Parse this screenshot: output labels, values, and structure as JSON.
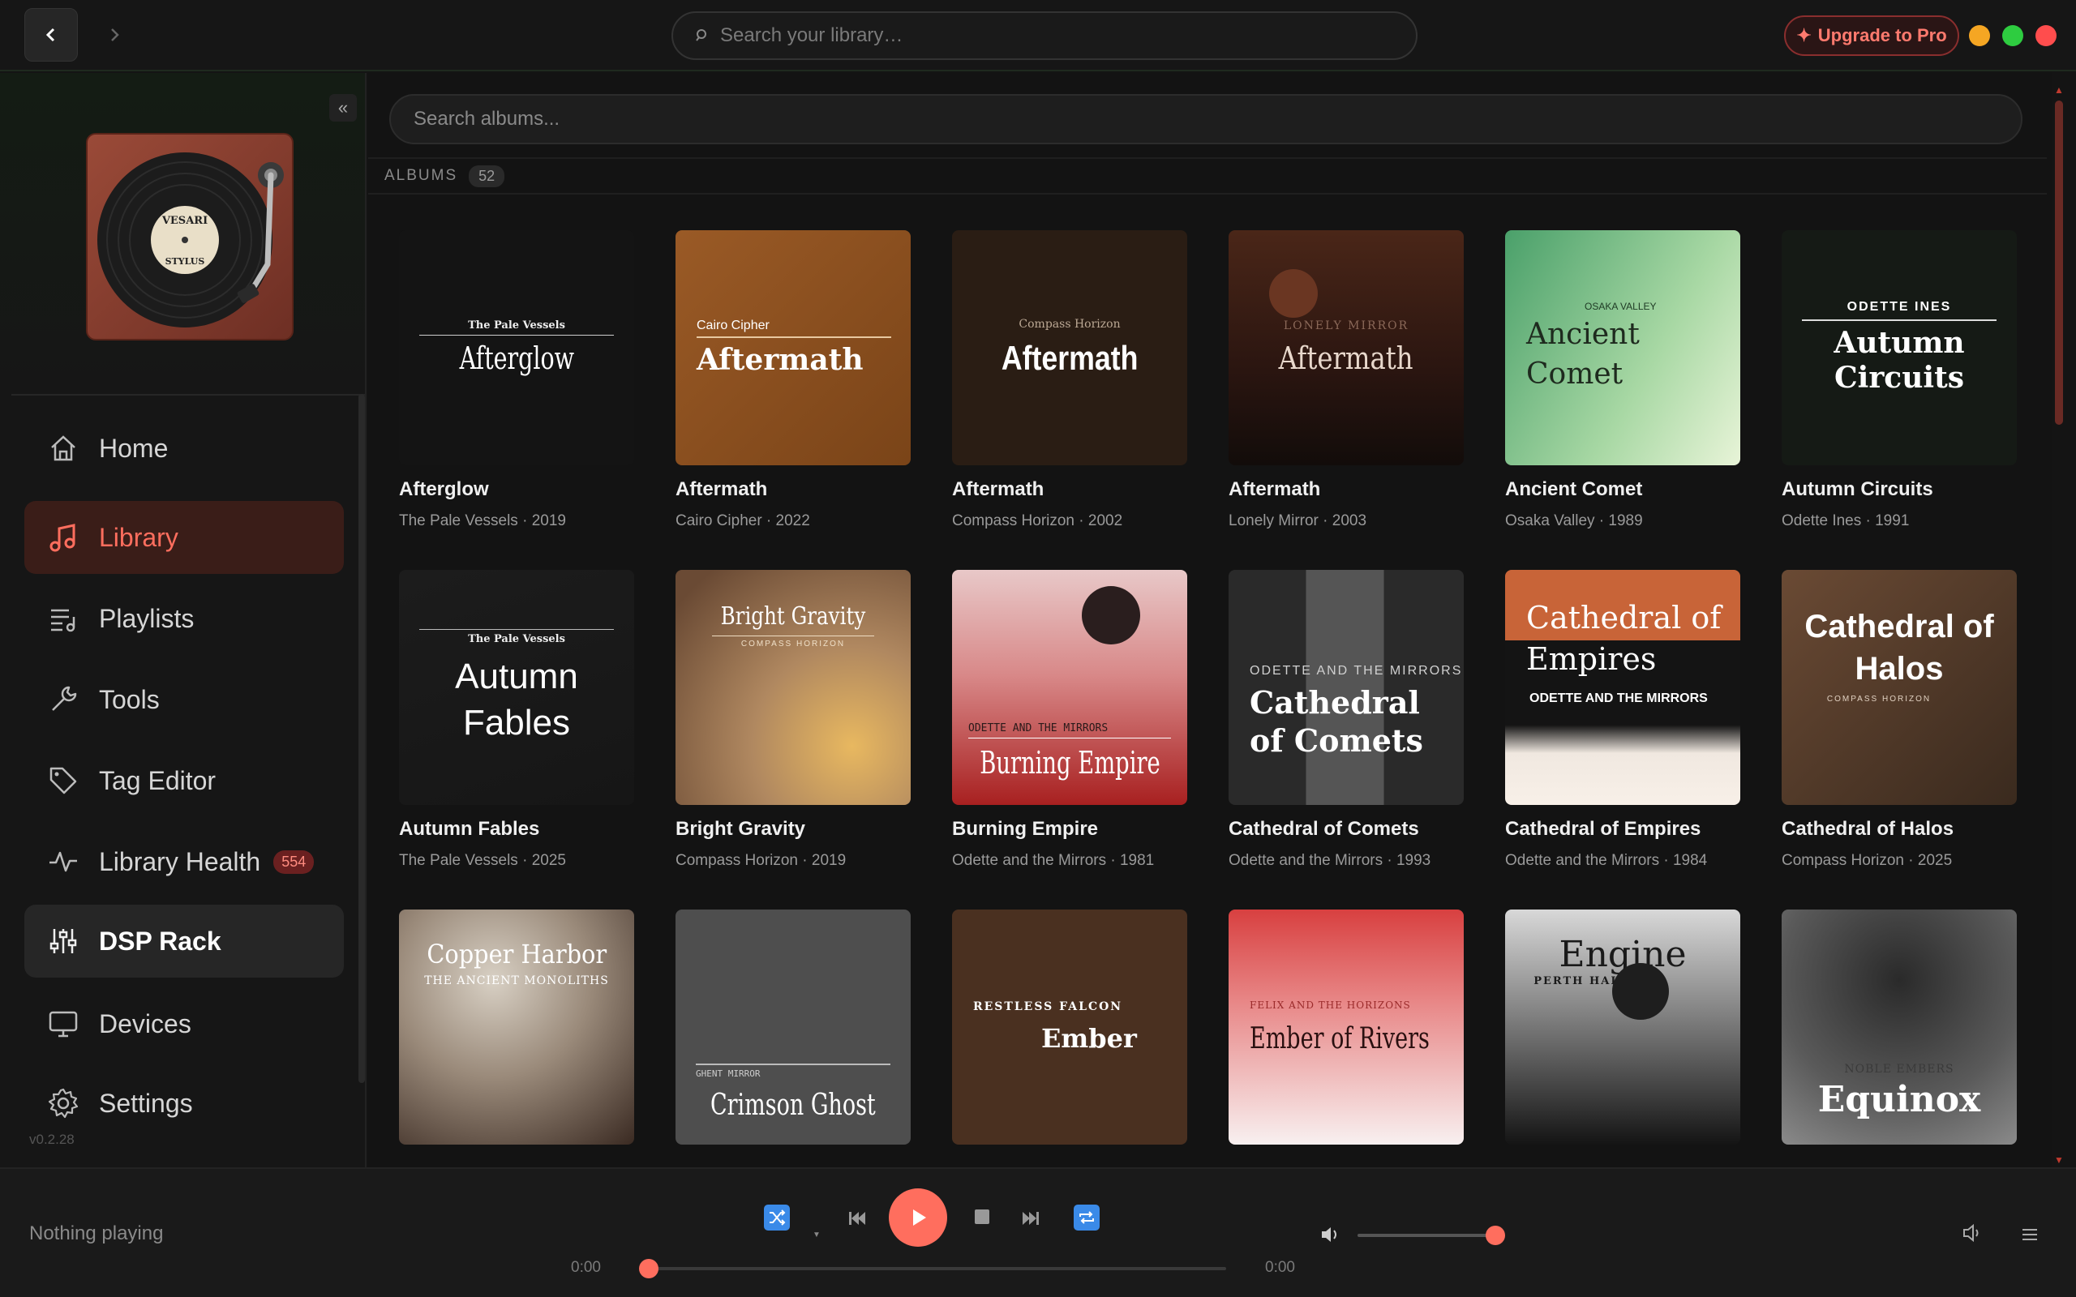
{
  "topbar": {
    "search_placeholder": "Search your library…",
    "upgrade_label": "Upgrade to Pro",
    "window_colors": [
      "#f5a623",
      "#2ecc40",
      "#ff4d4d"
    ]
  },
  "sidebar": {
    "logo_text_top": "VESARI",
    "logo_text_bottom": "STYLUS",
    "items": [
      {
        "label": "Home",
        "icon": "home-icon"
      },
      {
        "label": "Library",
        "icon": "music-note-icon",
        "active": true
      },
      {
        "label": "Playlists",
        "icon": "playlist-icon"
      },
      {
        "label": "Tools",
        "icon": "wrench-icon"
      },
      {
        "label": "Tag Editor",
        "icon": "tag-icon"
      },
      {
        "label": "Library Health",
        "icon": "pulse-icon",
        "badge": "554"
      },
      {
        "label": "DSP Rack",
        "icon": "sliders-icon"
      },
      {
        "label": "Devices",
        "icon": "monitor-icon"
      },
      {
        "label": "Settings",
        "icon": "gear-icon"
      }
    ],
    "version": "v0.2.28"
  },
  "main": {
    "search_placeholder": "Search albums...",
    "section_label": "ALBUMS",
    "count": "52",
    "albums": [
      {
        "title": "Afterglow",
        "subtitle": "The Pale Vessels · 2019",
        "cover_small": "The Pale Vessels",
        "cover_big": "Afterglow"
      },
      {
        "title": "Aftermath",
        "subtitle": "Cairo Cipher · 2022",
        "cover_small": "Cairo Cipher",
        "cover_big": "Aftermath"
      },
      {
        "title": "Aftermath",
        "subtitle": "Compass Horizon · 2002",
        "cover_small": "Compass Horizon",
        "cover_big": "Aftermath"
      },
      {
        "title": "Aftermath",
        "subtitle": "Lonely Mirror · 2003",
        "cover_small": "LONELY MIRROR",
        "cover_big": "Aftermath"
      },
      {
        "title": "Ancient Comet",
        "subtitle": "Osaka Valley · 1989",
        "cover_small": "OSAKA VALLEY",
        "cover_big": "Ancient Comet"
      },
      {
        "title": "Autumn Circuits",
        "subtitle": "Odette Ines · 1991",
        "cover_small": "ODETTE INES",
        "cover_big": "Autumn Circuits"
      },
      {
        "title": "Autumn Fables",
        "subtitle": "The Pale Vessels · 2025",
        "cover_small": "The Pale Vessels",
        "cover_big": "Autumn Fables"
      },
      {
        "title": "Bright Gravity",
        "subtitle": "Compass Horizon · 2019",
        "cover_small": "COMPASS HORIZON",
        "cover_big": "Bright Gravity"
      },
      {
        "title": "Burning Empire",
        "subtitle": "Odette and the Mirrors · 1981",
        "cover_small": "ODETTE AND THE MIRRORS",
        "cover_big": "Burning Empire"
      },
      {
        "title": "Cathedral of Comets",
        "subtitle": "Odette and the Mirrors · 1993",
        "cover_small": "ODETTE AND THE MIRRORS",
        "cover_big": "Cathedral of Comets"
      },
      {
        "title": "Cathedral of Empires",
        "subtitle": "Odette and the Mirrors · 1984",
        "cover_small": "ODETTE AND THE MIRRORS",
        "cover_big": "Cathedral of Empires"
      },
      {
        "title": "Cathedral of Halos",
        "subtitle": "Compass Horizon · 2025",
        "cover_small": "COMPASS HORIZON",
        "cover_big": "Cathedral of Halos"
      },
      {
        "title": "",
        "subtitle": "",
        "cover_small": "THE ANCIENT MONOLITHS",
        "cover_big": "Copper Harbor"
      },
      {
        "title": "",
        "subtitle": "",
        "cover_small": "GHENT MIRROR",
        "cover_big": "Crimson Ghost"
      },
      {
        "title": "",
        "subtitle": "",
        "cover_small": "RESTLESS FALCON",
        "cover_big": "Ember"
      },
      {
        "title": "",
        "subtitle": "",
        "cover_small": "FELIX AND THE HORIZONS",
        "cover_big": "Ember of Rivers"
      },
      {
        "title": "",
        "subtitle": "",
        "cover_small": "PERTH HALO",
        "cover_big": "Engine"
      },
      {
        "title": "",
        "subtitle": "",
        "cover_small": "NOBLE EMBERS",
        "cover_big": "Equinox"
      }
    ]
  },
  "player": {
    "now_playing": "Nothing playing",
    "time_elapsed": "0:00",
    "time_total": "0:00",
    "progress": 0,
    "volume": 0.9
  },
  "accent_color": "#ff6e5e"
}
